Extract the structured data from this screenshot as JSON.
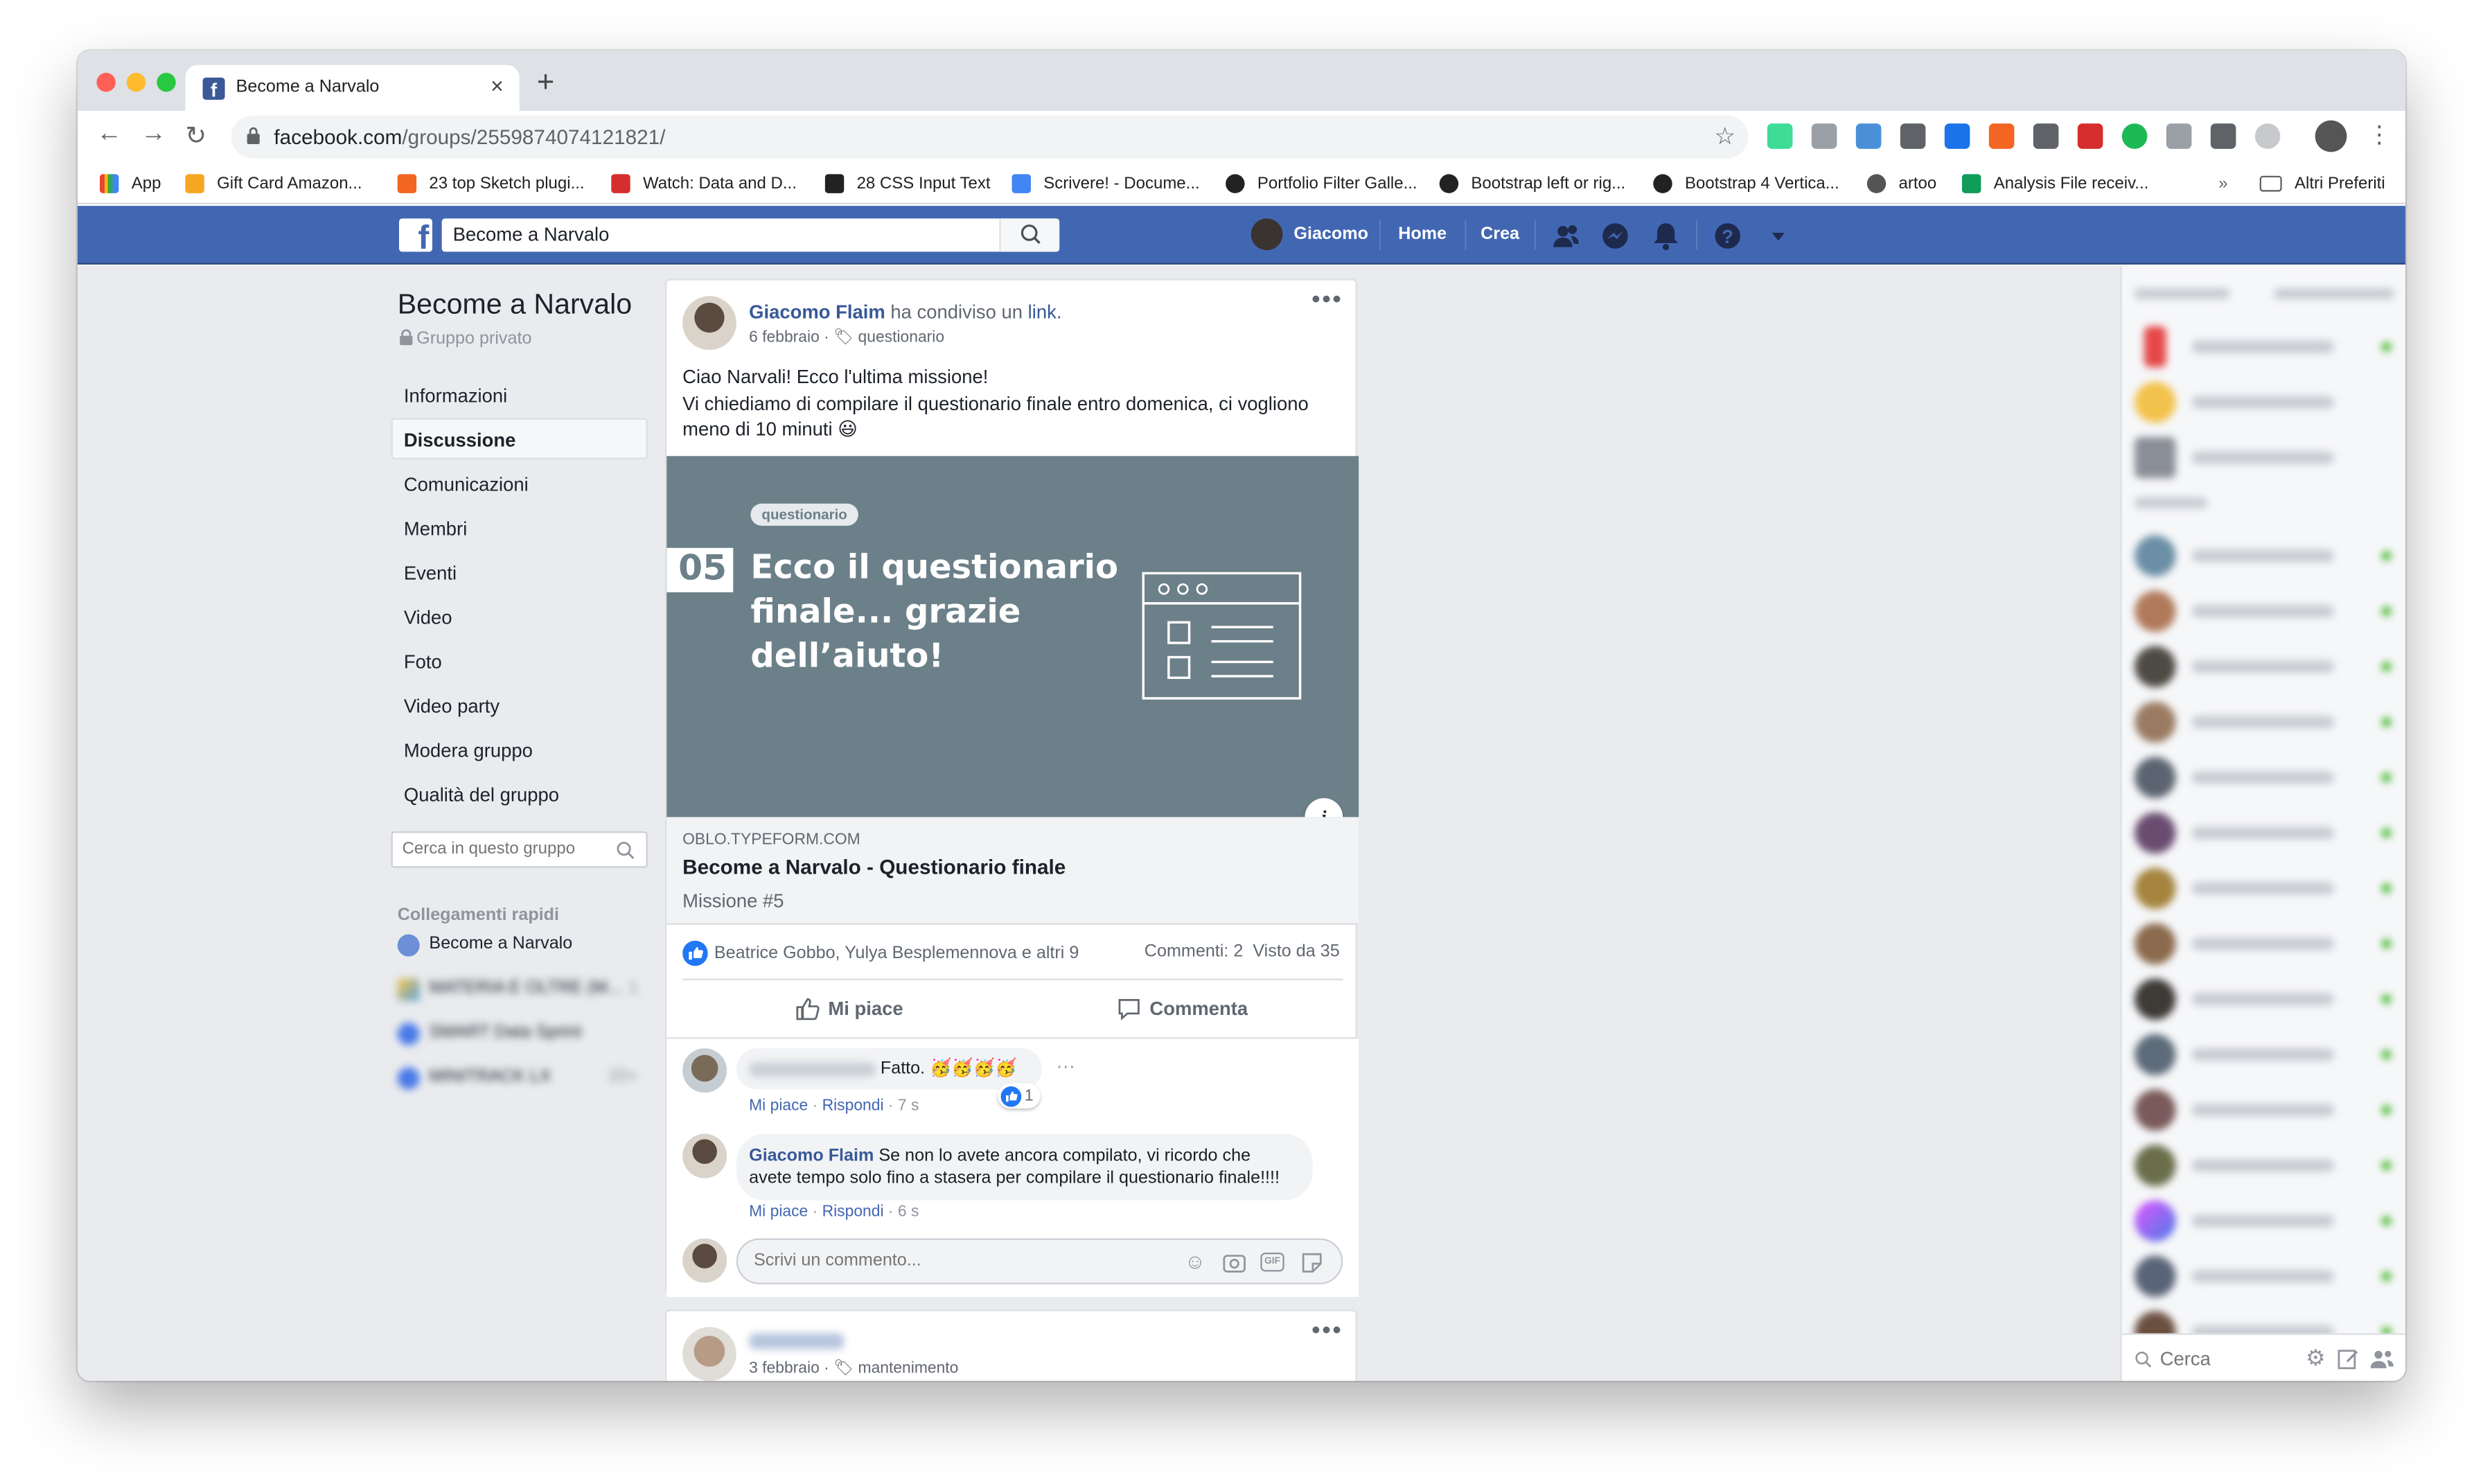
{
  "browser": {
    "tab_title": "Become a Narvalo",
    "url_host": "facebook.com",
    "url_path": "/groups/2559874074121821/",
    "bookmarks": [
      {
        "label": "App",
        "color": "#ea4335"
      },
      {
        "label": "Gift Card Amazon...",
        "color": "#f5a623"
      },
      {
        "label": "23 top Sketch plugi...",
        "color": "#f26522"
      },
      {
        "label": "Watch: Data and D...",
        "color": "#d62e2e"
      },
      {
        "label": "28 CSS Input Text",
        "color": "#222222"
      },
      {
        "label": "Scrivere! - Docume...",
        "color": "#4285f4"
      },
      {
        "label": "Portfolio Filter Galle...",
        "color": "#222222"
      },
      {
        "label": "Bootstrap left or rig...",
        "color": "#222222"
      },
      {
        "label": "Bootstrap 4 Vertica...",
        "color": "#222222"
      },
      {
        "label": "artoo",
        "color": "#555555"
      },
      {
        "label": "Analysis File receiv...",
        "color": "#0f9d58"
      }
    ],
    "bookmarks_overflow": "»",
    "other_bookmarks": "Altri Preferiti"
  },
  "fb": {
    "search_value": "Become a Narvalo",
    "user_name": "Giacomo",
    "nav_home": "Home",
    "nav_create": "Crea"
  },
  "group": {
    "name": "Become a Narvalo",
    "privacy": "Gruppo privato",
    "nav": [
      "Informazioni",
      "Discussione",
      "Comunicazioni",
      "Membri",
      "Eventi",
      "Video",
      "Foto",
      "Video party",
      "Modera gruppo",
      "Qualità del gruppo"
    ],
    "selected_nav": "Discussione",
    "search_placeholder": "Cerca in questo gruppo",
    "quick_links_title": "Collegamenti rapidi",
    "quick_links": [
      {
        "label": "Become a Narvalo",
        "badge": ""
      },
      {
        "label": "MATERIA E OLTRE (M...",
        "badge": "1"
      },
      {
        "label": "SMART Data Sprint",
        "badge": ""
      },
      {
        "label": "MINITRACK LX",
        "badge": "20+"
      }
    ]
  },
  "post": {
    "author": "Giacomo Flaim",
    "shared_text": "ha condiviso un",
    "shared_link": "link.",
    "date": "6 febbraio",
    "topic": "questionario",
    "text_line1": "Ciao Narvali! Ecco l'ultima missione!",
    "text_line2": "Vi chiediamo di compilare il questionario finale entro domenica, ci vogliono meno di 10 minuti 😃",
    "image": {
      "badge": "questionario",
      "number": "05",
      "headline_1": "Ecco il questionario",
      "headline_2": "finale... grazie",
      "headline_3": "dell’aiuto!",
      "bg_color": "#6c8089"
    },
    "link_domain": "OBLO.TYPEFORM.COM",
    "link_title": "Become a Narvalo - Questionario finale",
    "link_subtitle": "Missione #5",
    "reactions": "Beatrice Gobbo, Yulya Besplemennova e altri 9",
    "comments_count": "Commenti: 2",
    "seen_count": "Visto da 35",
    "like_label": "Mi piace",
    "comment_label": "Commenta",
    "comments": [
      {
        "author": "",
        "text": "Fatto. 🥳🥳🥳🥳",
        "reaction_count": "1",
        "like": "Mi piace",
        "reply": "Rispondi",
        "time": "7 s"
      },
      {
        "author": "Giacomo Flaim",
        "text": "Se non lo avete ancora compilato, vi ricordo che avete tempo solo fino a stasera per compilare il questionario finale!!!!",
        "like": "Mi piace",
        "reply": "Rispondi",
        "time": "6 s"
      }
    ],
    "comment_placeholder": "Scrivi un commento..."
  },
  "post2": {
    "date": "3 febbraio",
    "topic": "mantenimento"
  },
  "chat": {
    "search_placeholder": "Cerca"
  }
}
